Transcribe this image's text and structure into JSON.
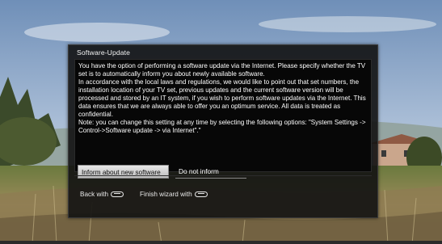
{
  "dialog": {
    "title": "Software-Update",
    "paragraphs": [
      "You have the option of performing a software update via the Internet. Please specify whether the TV set is to automatically inform you about newly available software.",
      "In accordance with the local laws and regulations, we would like to point out that set numbers, the installation location of your TV set, previous updates and the current software version will be processed and stored by an IT system, if you wish to perform software updates via the Internet. This data ensures that we are always able to offer you an optimum service. All data is treated as confidential.",
      "Note: you can change this setting at any time by selecting the following options: \"System Settings -> Control->Software update -> via Internet\".\""
    ],
    "buttons": {
      "inform": "Inform about new software",
      "no_inform": "Do not inform"
    }
  },
  "footer": {
    "back_label": "Back with",
    "back_icon": "back-key-icon",
    "finish_label": "Finish wizard with",
    "finish_icon": "end-key-icon"
  },
  "colors": {
    "dialog_bg": "#121212",
    "selected_button": "#d8d8d8",
    "text": "#ffffff"
  }
}
